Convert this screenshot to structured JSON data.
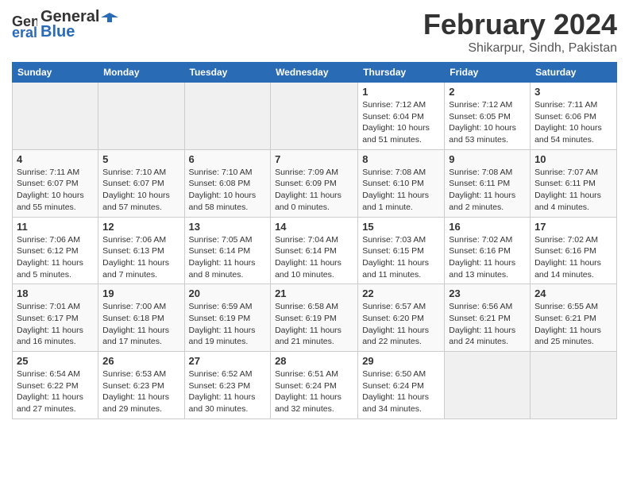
{
  "header": {
    "logo_line1": "General",
    "logo_line2": "Blue",
    "month_title": "February 2024",
    "location": "Shikarpur, Sindh, Pakistan"
  },
  "days_of_week": [
    "Sunday",
    "Monday",
    "Tuesday",
    "Wednesday",
    "Thursday",
    "Friday",
    "Saturday"
  ],
  "weeks": [
    [
      {
        "num": "",
        "info": ""
      },
      {
        "num": "",
        "info": ""
      },
      {
        "num": "",
        "info": ""
      },
      {
        "num": "",
        "info": ""
      },
      {
        "num": "1",
        "info": "Sunrise: 7:12 AM\nSunset: 6:04 PM\nDaylight: 10 hours\nand 51 minutes."
      },
      {
        "num": "2",
        "info": "Sunrise: 7:12 AM\nSunset: 6:05 PM\nDaylight: 10 hours\nand 53 minutes."
      },
      {
        "num": "3",
        "info": "Sunrise: 7:11 AM\nSunset: 6:06 PM\nDaylight: 10 hours\nand 54 minutes."
      }
    ],
    [
      {
        "num": "4",
        "info": "Sunrise: 7:11 AM\nSunset: 6:07 PM\nDaylight: 10 hours\nand 55 minutes."
      },
      {
        "num": "5",
        "info": "Sunrise: 7:10 AM\nSunset: 6:07 PM\nDaylight: 10 hours\nand 57 minutes."
      },
      {
        "num": "6",
        "info": "Sunrise: 7:10 AM\nSunset: 6:08 PM\nDaylight: 10 hours\nand 58 minutes."
      },
      {
        "num": "7",
        "info": "Sunrise: 7:09 AM\nSunset: 6:09 PM\nDaylight: 11 hours\nand 0 minutes."
      },
      {
        "num": "8",
        "info": "Sunrise: 7:08 AM\nSunset: 6:10 PM\nDaylight: 11 hours\nand 1 minute."
      },
      {
        "num": "9",
        "info": "Sunrise: 7:08 AM\nSunset: 6:11 PM\nDaylight: 11 hours\nand 2 minutes."
      },
      {
        "num": "10",
        "info": "Sunrise: 7:07 AM\nSunset: 6:11 PM\nDaylight: 11 hours\nand 4 minutes."
      }
    ],
    [
      {
        "num": "11",
        "info": "Sunrise: 7:06 AM\nSunset: 6:12 PM\nDaylight: 11 hours\nand 5 minutes."
      },
      {
        "num": "12",
        "info": "Sunrise: 7:06 AM\nSunset: 6:13 PM\nDaylight: 11 hours\nand 7 minutes."
      },
      {
        "num": "13",
        "info": "Sunrise: 7:05 AM\nSunset: 6:14 PM\nDaylight: 11 hours\nand 8 minutes."
      },
      {
        "num": "14",
        "info": "Sunrise: 7:04 AM\nSunset: 6:14 PM\nDaylight: 11 hours\nand 10 minutes."
      },
      {
        "num": "15",
        "info": "Sunrise: 7:03 AM\nSunset: 6:15 PM\nDaylight: 11 hours\nand 11 minutes."
      },
      {
        "num": "16",
        "info": "Sunrise: 7:02 AM\nSunset: 6:16 PM\nDaylight: 11 hours\nand 13 minutes."
      },
      {
        "num": "17",
        "info": "Sunrise: 7:02 AM\nSunset: 6:16 PM\nDaylight: 11 hours\nand 14 minutes."
      }
    ],
    [
      {
        "num": "18",
        "info": "Sunrise: 7:01 AM\nSunset: 6:17 PM\nDaylight: 11 hours\nand 16 minutes."
      },
      {
        "num": "19",
        "info": "Sunrise: 7:00 AM\nSunset: 6:18 PM\nDaylight: 11 hours\nand 17 minutes."
      },
      {
        "num": "20",
        "info": "Sunrise: 6:59 AM\nSunset: 6:19 PM\nDaylight: 11 hours\nand 19 minutes."
      },
      {
        "num": "21",
        "info": "Sunrise: 6:58 AM\nSunset: 6:19 PM\nDaylight: 11 hours\nand 21 minutes."
      },
      {
        "num": "22",
        "info": "Sunrise: 6:57 AM\nSunset: 6:20 PM\nDaylight: 11 hours\nand 22 minutes."
      },
      {
        "num": "23",
        "info": "Sunrise: 6:56 AM\nSunset: 6:21 PM\nDaylight: 11 hours\nand 24 minutes."
      },
      {
        "num": "24",
        "info": "Sunrise: 6:55 AM\nSunset: 6:21 PM\nDaylight: 11 hours\nand 25 minutes."
      }
    ],
    [
      {
        "num": "25",
        "info": "Sunrise: 6:54 AM\nSunset: 6:22 PM\nDaylight: 11 hours\nand 27 minutes."
      },
      {
        "num": "26",
        "info": "Sunrise: 6:53 AM\nSunset: 6:23 PM\nDaylight: 11 hours\nand 29 minutes."
      },
      {
        "num": "27",
        "info": "Sunrise: 6:52 AM\nSunset: 6:23 PM\nDaylight: 11 hours\nand 30 minutes."
      },
      {
        "num": "28",
        "info": "Sunrise: 6:51 AM\nSunset: 6:24 PM\nDaylight: 11 hours\nand 32 minutes."
      },
      {
        "num": "29",
        "info": "Sunrise: 6:50 AM\nSunset: 6:24 PM\nDaylight: 11 hours\nand 34 minutes."
      },
      {
        "num": "",
        "info": ""
      },
      {
        "num": "",
        "info": ""
      }
    ]
  ]
}
